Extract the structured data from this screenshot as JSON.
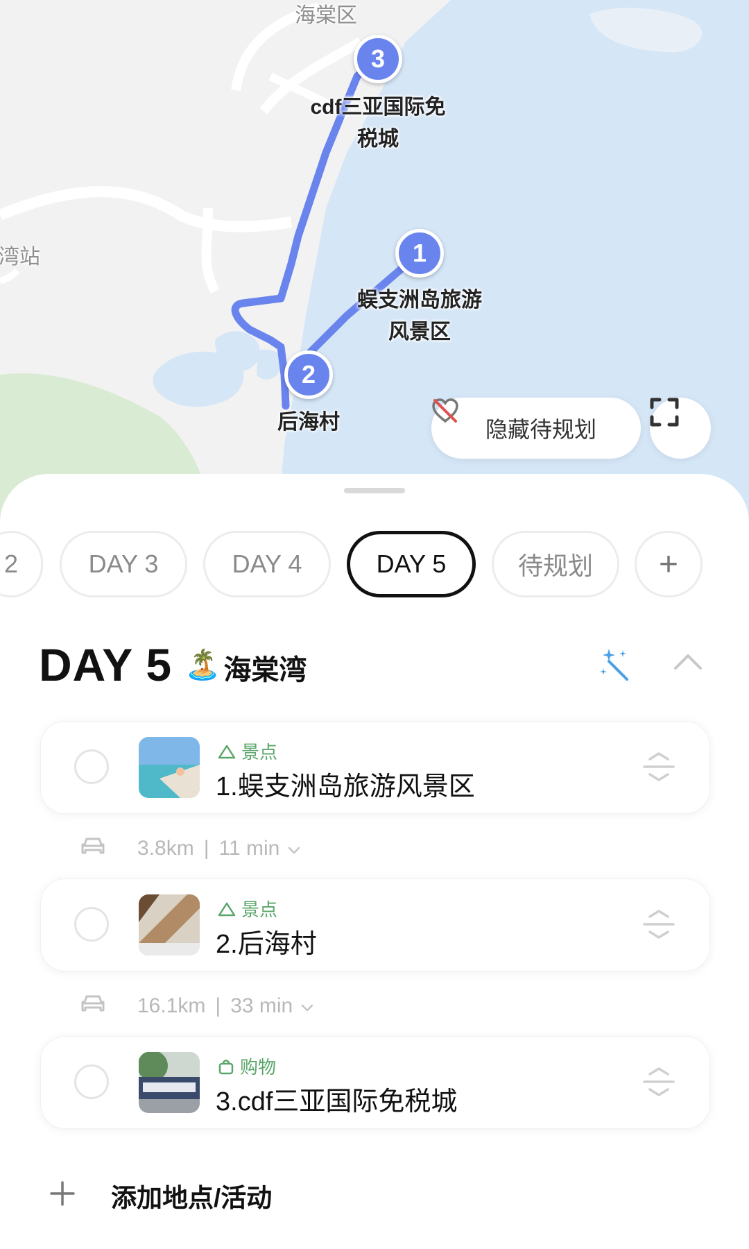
{
  "map": {
    "district_label": "海棠区",
    "station_label": "湾站",
    "places": [
      {
        "index": "1",
        "name": "蜈支洲岛旅游\n风景区"
      },
      {
        "index": "2",
        "name": "后海村"
      },
      {
        "index": "3",
        "name": "cdf三亚国际免\n税城"
      }
    ],
    "hide_button_label": "隐藏待规划",
    "fullscreen_icon": "fullscreen-icon"
  },
  "tabs": [
    {
      "label": "2"
    },
    {
      "label": "DAY 3"
    },
    {
      "label": "DAY 4"
    },
    {
      "label": "DAY 5",
      "active": true
    },
    {
      "label": "待规划"
    },
    {
      "label": "+"
    }
  ],
  "day": {
    "title": "DAY 5",
    "emoji": "🏝️",
    "area": "海棠湾"
  },
  "items": [
    {
      "category": "景点",
      "category_icon": "mountain-icon",
      "name": "1.蜈支洲岛旅游风景区"
    },
    {
      "category": "景点",
      "category_icon": "mountain-icon",
      "name": "2.后海村"
    },
    {
      "category": "购物",
      "category_icon": "shopping-bag-icon",
      "name": "3.cdf三亚国际免税城"
    }
  ],
  "routes": [
    {
      "distance": "3.8km",
      "duration": "11 min"
    },
    {
      "distance": "16.1km",
      "duration": "33 min"
    }
  ],
  "add_label": "添加地点/活动",
  "colors": {
    "route_blue": "#6a84ee",
    "sea": "#d5e6f7",
    "land": "#f2f2f2",
    "park_green": "#d9ecd3",
    "category_green": "#5aa66a"
  }
}
